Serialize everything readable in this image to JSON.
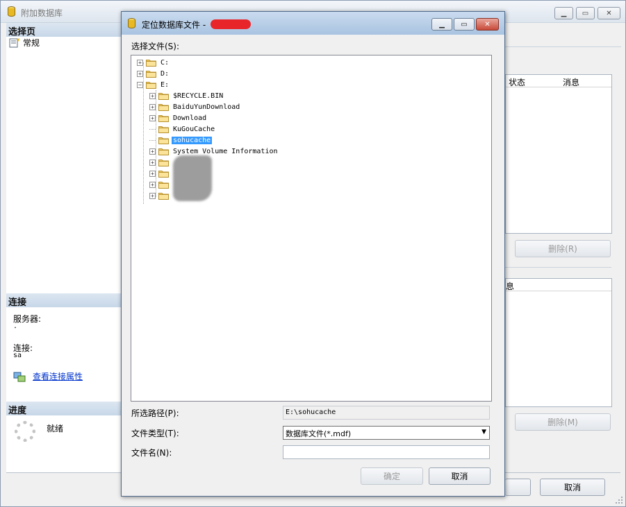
{
  "outer": {
    "title": "附加数据库",
    "pages_header": "选择页",
    "page_general": "常规",
    "connection_header": "连接",
    "server_label": "服务器:",
    "server_value": ".",
    "connection_label": "连接:",
    "connection_value": "sa",
    "view_props_link": "查看连接属性",
    "progress_header": "进度",
    "progress_status": "就绪",
    "grid1_col_status": "状态",
    "grid1_col_message": "消息",
    "remove_button_1": "删除(R)",
    "grid2_col_message": "息",
    "remove_button_2": "删除(M)",
    "cancel_button": "取消"
  },
  "dialog": {
    "title": "定位数据库文件 -",
    "select_file_label": "选择文件(S):",
    "tree": [
      {
        "label": "C:",
        "level": 0,
        "expander": "+"
      },
      {
        "label": "D:",
        "level": 0,
        "expander": "+"
      },
      {
        "label": "E:",
        "level": 0,
        "expander": "-"
      },
      {
        "label": "$RECYCLE.BIN",
        "level": 1,
        "expander": "+"
      },
      {
        "label": "BaiduYunDownload",
        "level": 1,
        "expander": "+"
      },
      {
        "label": "Download",
        "level": 1,
        "expander": "+"
      },
      {
        "label": "KuGouCache",
        "level": 1,
        "expander": ""
      },
      {
        "label": "sohucache",
        "level": 1,
        "expander": "",
        "selected": true
      },
      {
        "label": "System Volume Information",
        "level": 1,
        "expander": "+"
      },
      {
        "label": "",
        "level": 1,
        "expander": "+"
      },
      {
        "label": "",
        "level": 1,
        "expander": "+"
      },
      {
        "label": "",
        "level": 1,
        "expander": "+"
      },
      {
        "label": "",
        "level": 1,
        "expander": "+"
      }
    ],
    "selected_path_label": "所选路径(P):",
    "selected_path_value": "E:\\sohucache",
    "file_type_label": "文件类型(T):",
    "file_type_value": "数据库文件(*.mdf)",
    "file_name_label": "文件名(N):",
    "file_name_value": "",
    "ok_button": "确定",
    "cancel_button": "取消"
  },
  "colors": {
    "selection": "#3399ff",
    "section_header": "#c8d7e8",
    "link": "#0033cc",
    "redaction": "#e8262a"
  }
}
